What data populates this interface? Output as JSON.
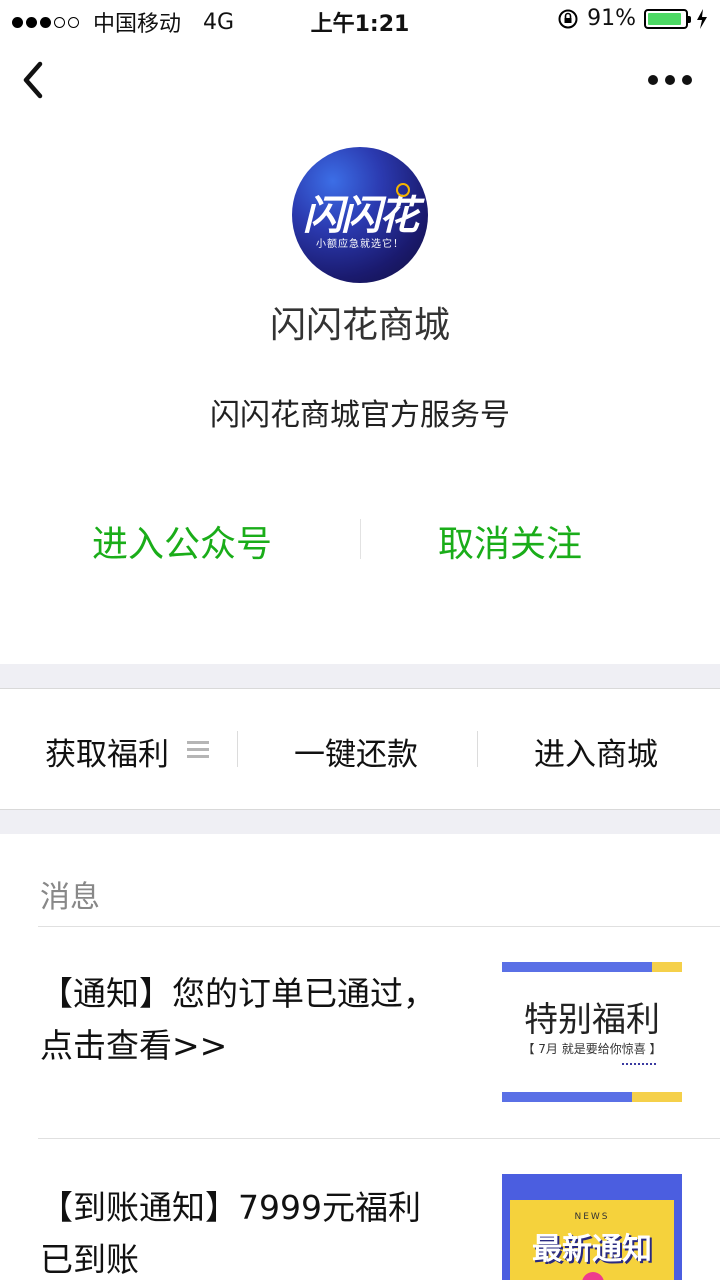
{
  "status_bar": {
    "carrier": "中国移动",
    "network": "4G",
    "time": "上午1:21",
    "battery": "91%",
    "battery_level": 0.91
  },
  "nav": {
    "back_icon": "chevron-left-icon",
    "more_icon": "more-horizontal-icon"
  },
  "profile": {
    "avatar_logo": "闪闪花",
    "avatar_slogan": "小额应急就选它！",
    "name": "闪闪花商城",
    "description": "闪闪花商城官方服务号"
  },
  "actions": {
    "enter": "进入公众号",
    "unfollow": "取消关注",
    "accent_color": "#1aad19"
  },
  "menu": {
    "items": [
      {
        "label": "获取福利",
        "icon": "list-icon"
      },
      {
        "label": "一键还款"
      },
      {
        "label": "进入商城"
      }
    ]
  },
  "messages": {
    "label": "消息",
    "items": [
      {
        "title": "【通知】您的订单已通过，点击查看>>",
        "thumb_main": "特别福利",
        "thumb_sub": "【 7月    就是要给你惊喜 】"
      },
      {
        "title": "【到账通知】7999元福利已到账",
        "thumb_small": "NEWS",
        "thumb_main": "最新通知"
      }
    ]
  }
}
